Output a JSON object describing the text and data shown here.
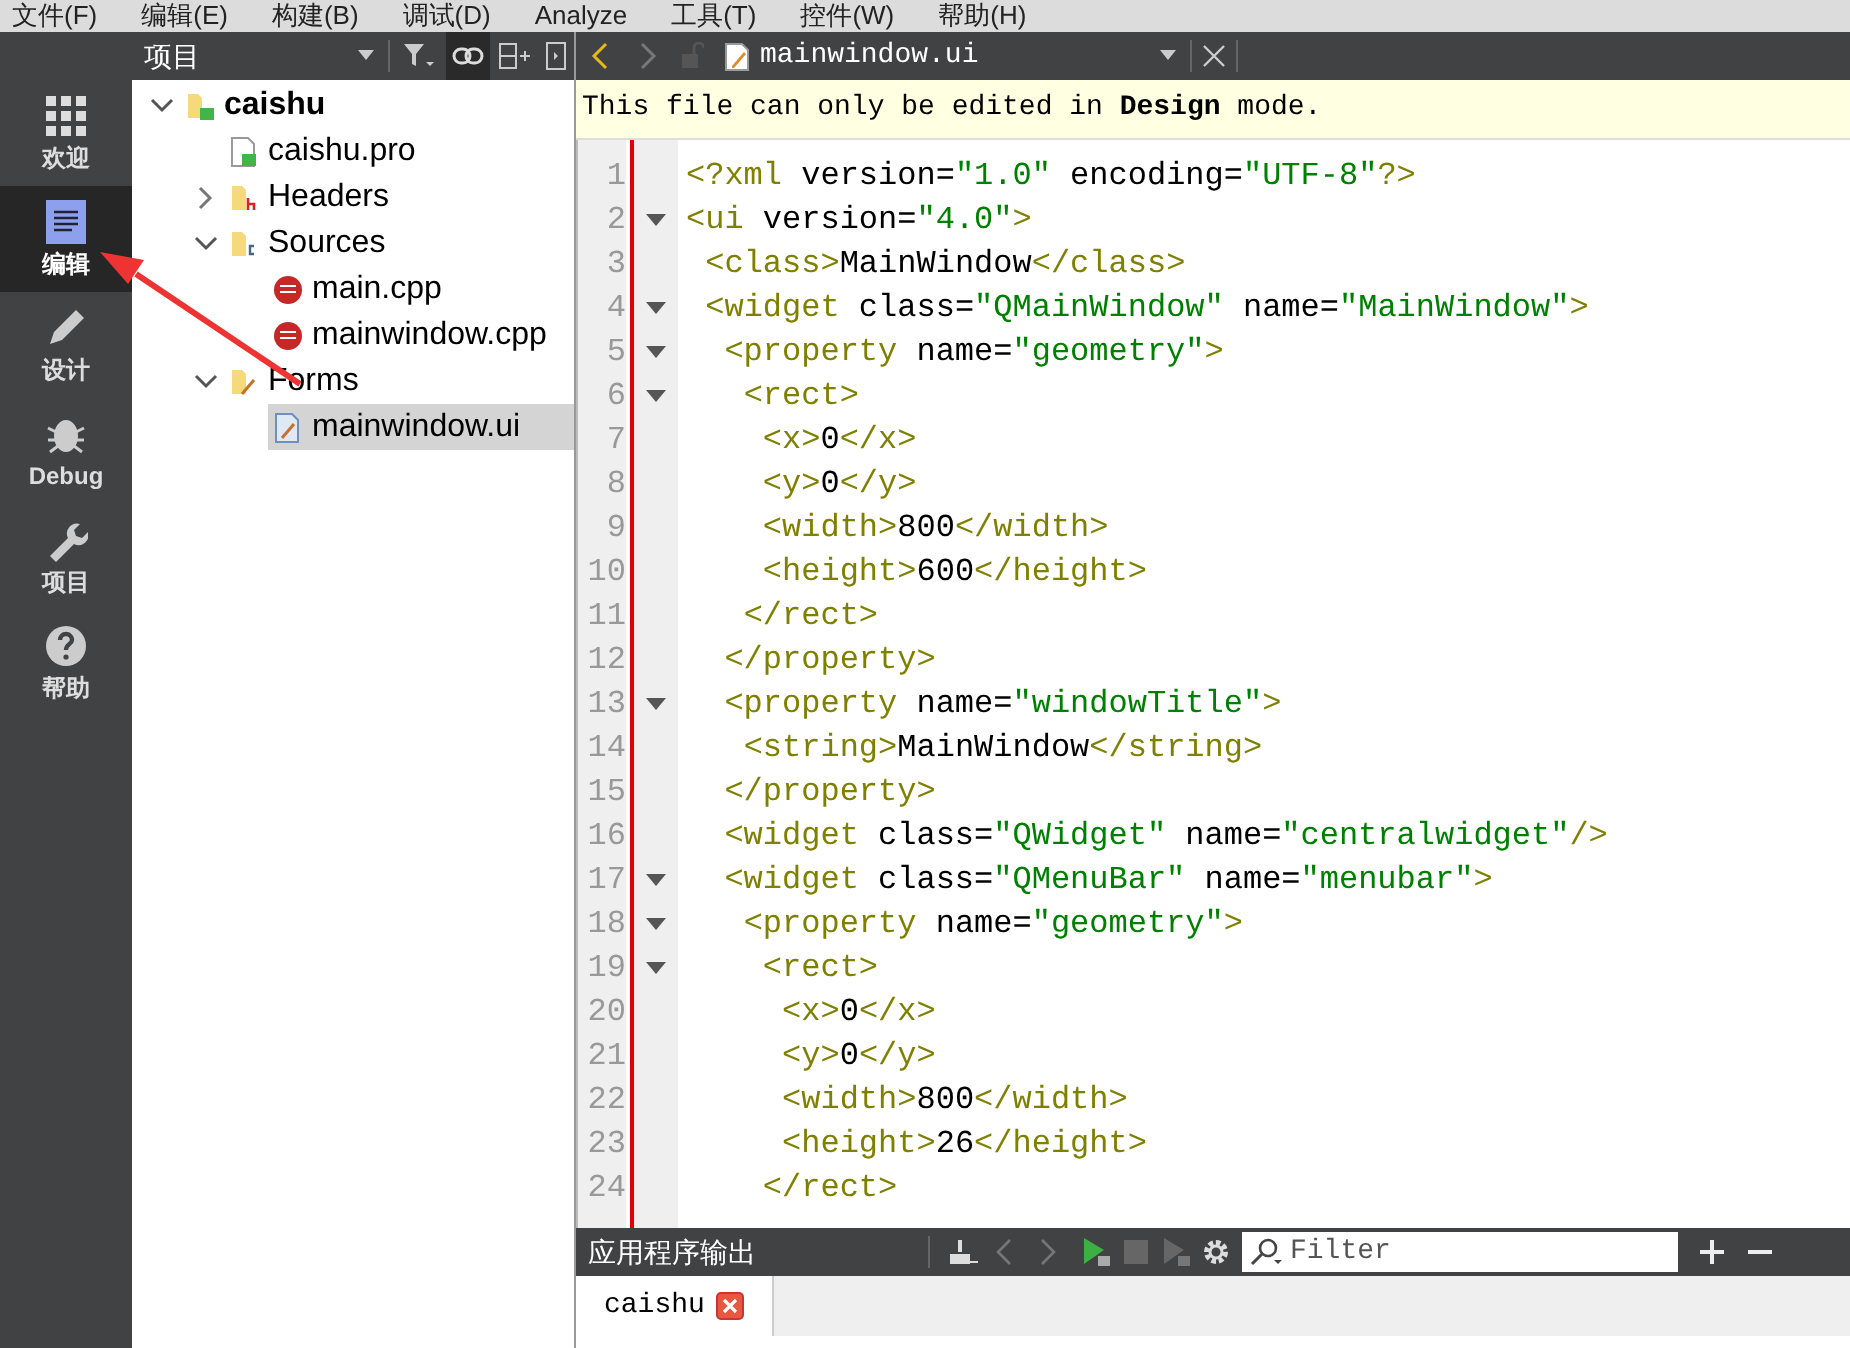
{
  "menu_bar": [
    "文件(F)",
    "编辑(E)",
    "构建(B)",
    "调试(D)",
    "Analyze",
    "工具(T)",
    "控件(W)",
    "帮助(H)"
  ],
  "sidebar": {
    "modes": [
      {
        "label": "欢迎",
        "selected": false
      },
      {
        "label": "编辑",
        "selected": true
      },
      {
        "label": "设计",
        "selected": false
      },
      {
        "label": "Debug",
        "selected": false
      },
      {
        "label": "项目",
        "selected": false
      },
      {
        "label": "帮助",
        "selected": false
      }
    ]
  },
  "project_panel": {
    "title": "项目",
    "tree": [
      {
        "label": "caishu",
        "kind": "project",
        "expanded": true,
        "selected": false,
        "children": [
          {
            "label": "caishu.pro",
            "kind": "pro-file",
            "selected": false
          },
          {
            "label": "Headers",
            "kind": "header-folder",
            "expanded": false,
            "selected": false
          },
          {
            "label": "Sources",
            "kind": "source-folder",
            "expanded": true,
            "selected": false,
            "children": [
              {
                "label": "main.cpp",
                "kind": "cpp-file",
                "selected": false
              },
              {
                "label": "mainwindow.cpp",
                "kind": "cpp-file",
                "selected": false
              }
            ]
          },
          {
            "label": "Forms",
            "kind": "forms-folder",
            "expanded": true,
            "selected": false,
            "children": [
              {
                "label": "mainwindow.ui",
                "kind": "ui-file",
                "selected": true
              }
            ]
          }
        ]
      }
    ]
  },
  "editor": {
    "file_name": "mainwindow.ui",
    "info_bar": "This file can only be edited in **Design** mode.",
    "lines": [
      {
        "number": "1",
        "text": "<?xml version=\"1.0\" encoding=\"UTF-8\"?>",
        "foldable": false
      },
      {
        "number": "2",
        "text": "<ui version=\"4.0\">",
        "foldable": true
      },
      {
        "number": "3",
        "text": " <class>MainWindow</class>",
        "foldable": false
      },
      {
        "number": "4",
        "text": " <widget class=\"QMainWindow\" name=\"MainWindow\">",
        "foldable": true
      },
      {
        "number": "5",
        "text": "  <property name=\"geometry\">",
        "foldable": true
      },
      {
        "number": "6",
        "text": "   <rect>",
        "foldable": true
      },
      {
        "number": "7",
        "text": "    <x>0</x>",
        "foldable": false
      },
      {
        "number": "8",
        "text": "    <y>0</y>",
        "foldable": false
      },
      {
        "number": "9",
        "text": "    <width>800</width>",
        "foldable": false
      },
      {
        "number": "10",
        "text": "    <height>600</height>",
        "foldable": false
      },
      {
        "number": "11",
        "text": "   </rect>",
        "foldable": false
      },
      {
        "number": "12",
        "text": "  </property>",
        "foldable": false
      },
      {
        "number": "13",
        "text": "  <property name=\"windowTitle\">",
        "foldable": true
      },
      {
        "number": "14",
        "text": "   <string>MainWindow</string>",
        "foldable": false
      },
      {
        "number": "15",
        "text": "  </property>",
        "foldable": false
      },
      {
        "number": "16",
        "text": "  <widget class=\"QWidget\" name=\"centralwidget\"/>",
        "foldable": false
      },
      {
        "number": "17",
        "text": "  <widget class=\"QMenuBar\" name=\"menubar\">",
        "foldable": true
      },
      {
        "number": "18",
        "text": "   <property name=\"geometry\">",
        "foldable": true
      },
      {
        "number": "19",
        "text": "    <rect>",
        "foldable": true
      },
      {
        "number": "20",
        "text": "     <x>0</x>",
        "foldable": false
      },
      {
        "number": "21",
        "text": "     <y>0</y>",
        "foldable": false
      },
      {
        "number": "22",
        "text": "     <width>800</width>",
        "foldable": false
      },
      {
        "number": "23",
        "text": "     <height>26</height>",
        "foldable": false
      },
      {
        "number": "24",
        "text": "    </rect>",
        "foldable": false
      }
    ]
  },
  "output_panel": {
    "title": "应用程序输出",
    "filter": {
      "placeholder": "Filter"
    },
    "tabs": [
      {
        "label": "caishu",
        "selected": true
      }
    ]
  }
}
